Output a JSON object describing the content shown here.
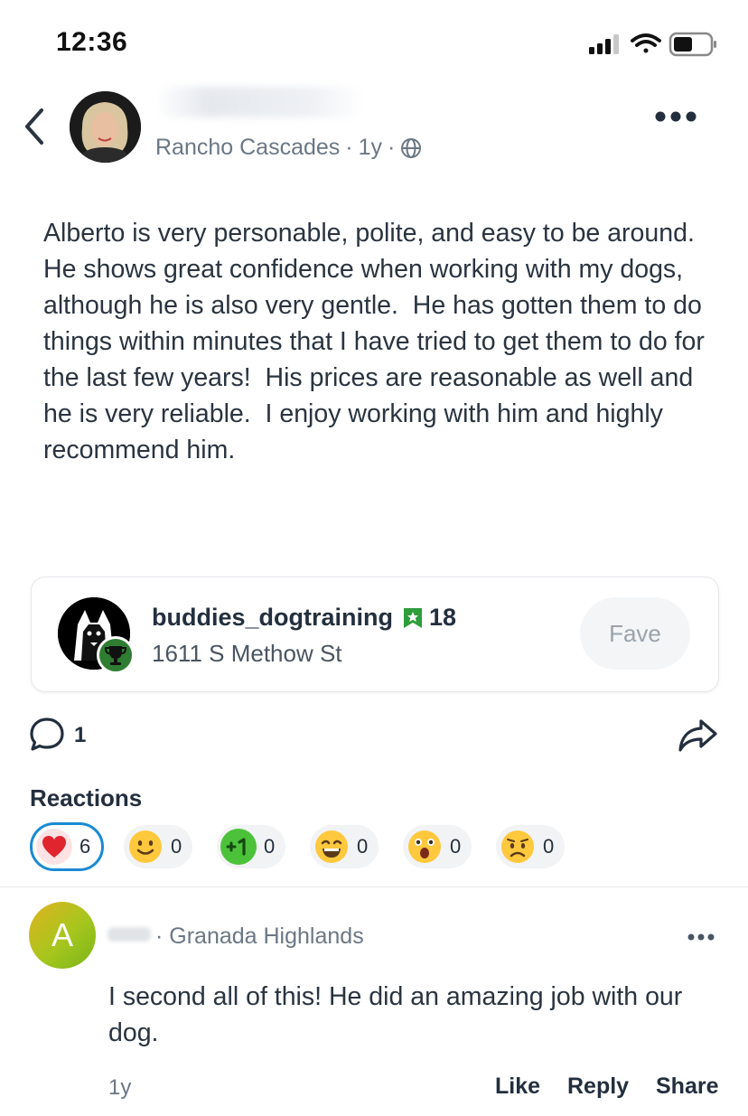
{
  "status_bar": {
    "time": "12:36"
  },
  "post": {
    "author_location": "Rancho Cascades",
    "age": "1y",
    "body": "Alberto is very personable, polite, and easy to be around.  He shows great confidence when working with my dogs, although he is also very gentle.  He has gotten them to do things within minutes that I have tried to get them to do for the last few years!  His prices are reasonable as well and he is very reliable.  I enjoy working with him and highly recommend him."
  },
  "business": {
    "name": "buddies_dogtraining",
    "fave_count": "18",
    "address": "1611 S Methow St",
    "fave_label": "Fave"
  },
  "actions": {
    "comment_count": "1"
  },
  "reactions": {
    "title": "Reactions",
    "items": [
      {
        "icon": "heart-icon",
        "count": "6"
      },
      {
        "icon": "smile-emoji-icon",
        "count": "0"
      },
      {
        "icon": "plus-one-icon",
        "count": "0"
      },
      {
        "icon": "laugh-emoji-icon",
        "count": "0"
      },
      {
        "icon": "wow-emoji-icon",
        "count": "0"
      },
      {
        "icon": "sad-emoji-icon",
        "count": "0"
      }
    ]
  },
  "comment": {
    "avatar_letter": "A",
    "location": "· Granada Highlands",
    "text": "I second all of this! He did an amazing job with our dog.",
    "age": "1y",
    "like_label": "Like",
    "reply_label": "Reply",
    "share_label": "Share"
  },
  "colors": {
    "accent_blue": "#1a8ad4",
    "badge_green": "#2e7d32",
    "text_dark": "#232f3e"
  }
}
